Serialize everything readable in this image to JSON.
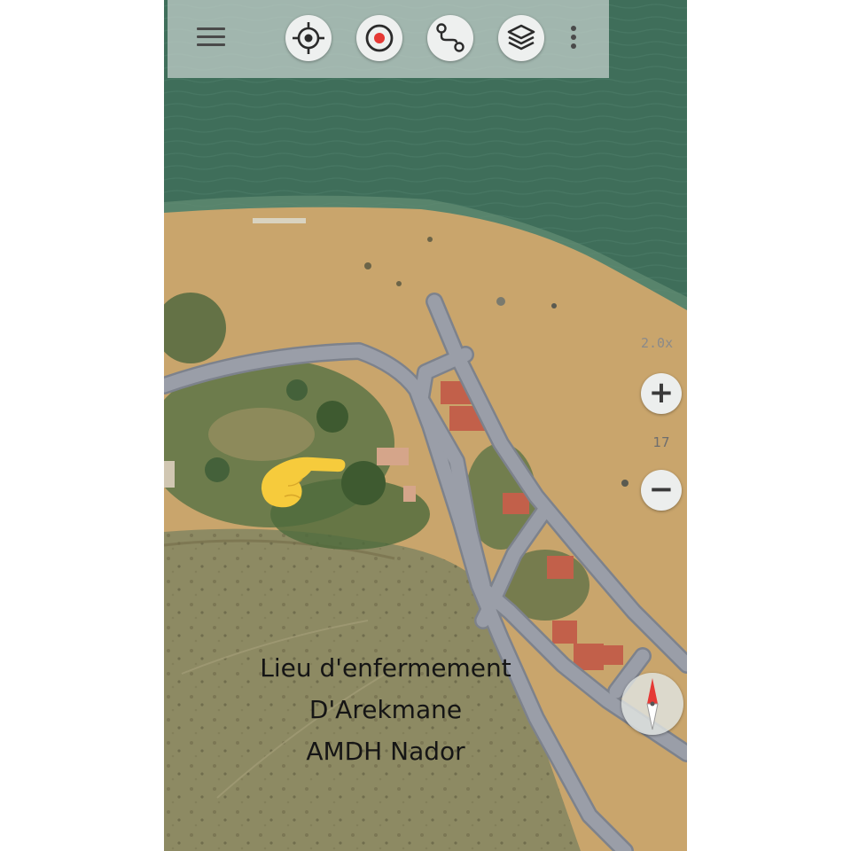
{
  "map": {
    "style": "satellite",
    "zoom_factor": "2.0x",
    "zoom_level": "17",
    "zoom_in_label": "+",
    "zoom_out_label": "−",
    "colors": {
      "sea": "#3f6e5a",
      "beach": "#c9a56c",
      "vegetation": "#5d7447",
      "dry_land": "#8d8a63",
      "road": "#9a9ea8",
      "road_outline": "#80858f",
      "roof": "#c2604a",
      "accent_red": "#e53935"
    }
  },
  "toolbar": {
    "menu_icon": "hamburger-menu-icon",
    "buttons": [
      {
        "icon": "crosshair-locate-icon"
      },
      {
        "icon": "record-track-icon"
      },
      {
        "icon": "route-icon"
      },
      {
        "icon": "layers-icon"
      }
    ],
    "overflow_icon": "more-vertical-icon"
  },
  "compass": {
    "icon": "compass-icon"
  },
  "annotation": {
    "pointer": "pointing-hand-icon",
    "pointer_color": "#f6cb3c",
    "caption_lines": [
      "Lieu d'enfermement",
      "D'Arekmane",
      "AMDH Nador"
    ]
  }
}
